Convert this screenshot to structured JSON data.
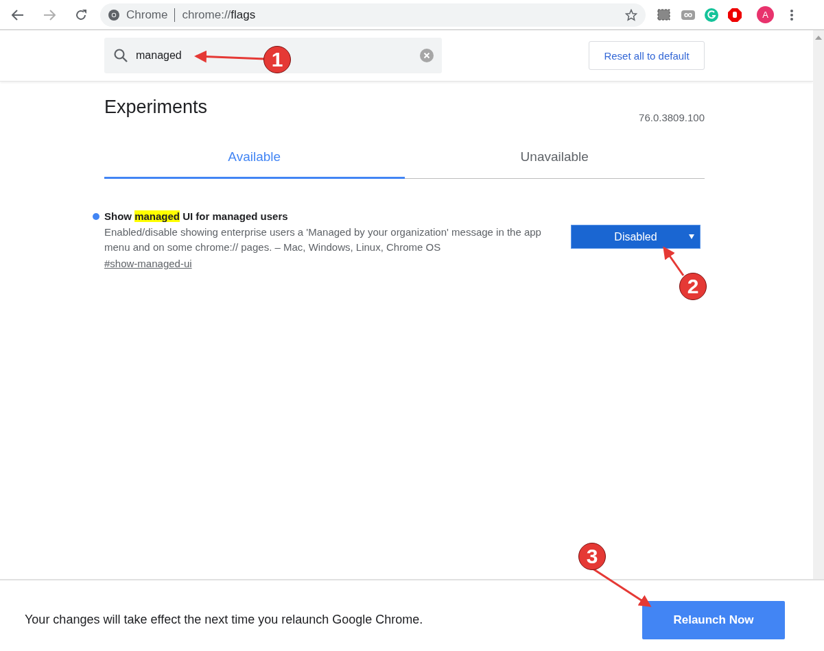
{
  "browser": {
    "site_label": "Chrome",
    "url_scheme": "chrome://",
    "url_path": "flags",
    "avatar_letter": "A"
  },
  "search": {
    "value": "managed"
  },
  "reset_button": "Reset all to default",
  "heading": "Experiments",
  "version": "76.0.3809.100",
  "tabs": [
    {
      "label": "Available",
      "selected": true
    },
    {
      "label": "Unavailable",
      "selected": false
    }
  ],
  "flags": [
    {
      "title": {
        "before": "Show ",
        "highlight": "managed",
        "after": " UI for managed users"
      },
      "description": "Enabled/disable showing enterprise users a 'Managed by your organization' message in the app menu and on some chrome:// pages. – Mac, Windows, Linux, Chrome OS",
      "link": "#show-managed-ui",
      "select": "Disabled"
    }
  ],
  "relaunch": {
    "message": "Your changes will take effect the next time you relaunch Google Chrome.",
    "button": "Relaunch Now"
  },
  "callouts": [
    {
      "number": "1"
    },
    {
      "number": "2"
    },
    {
      "number": "3"
    }
  ]
}
